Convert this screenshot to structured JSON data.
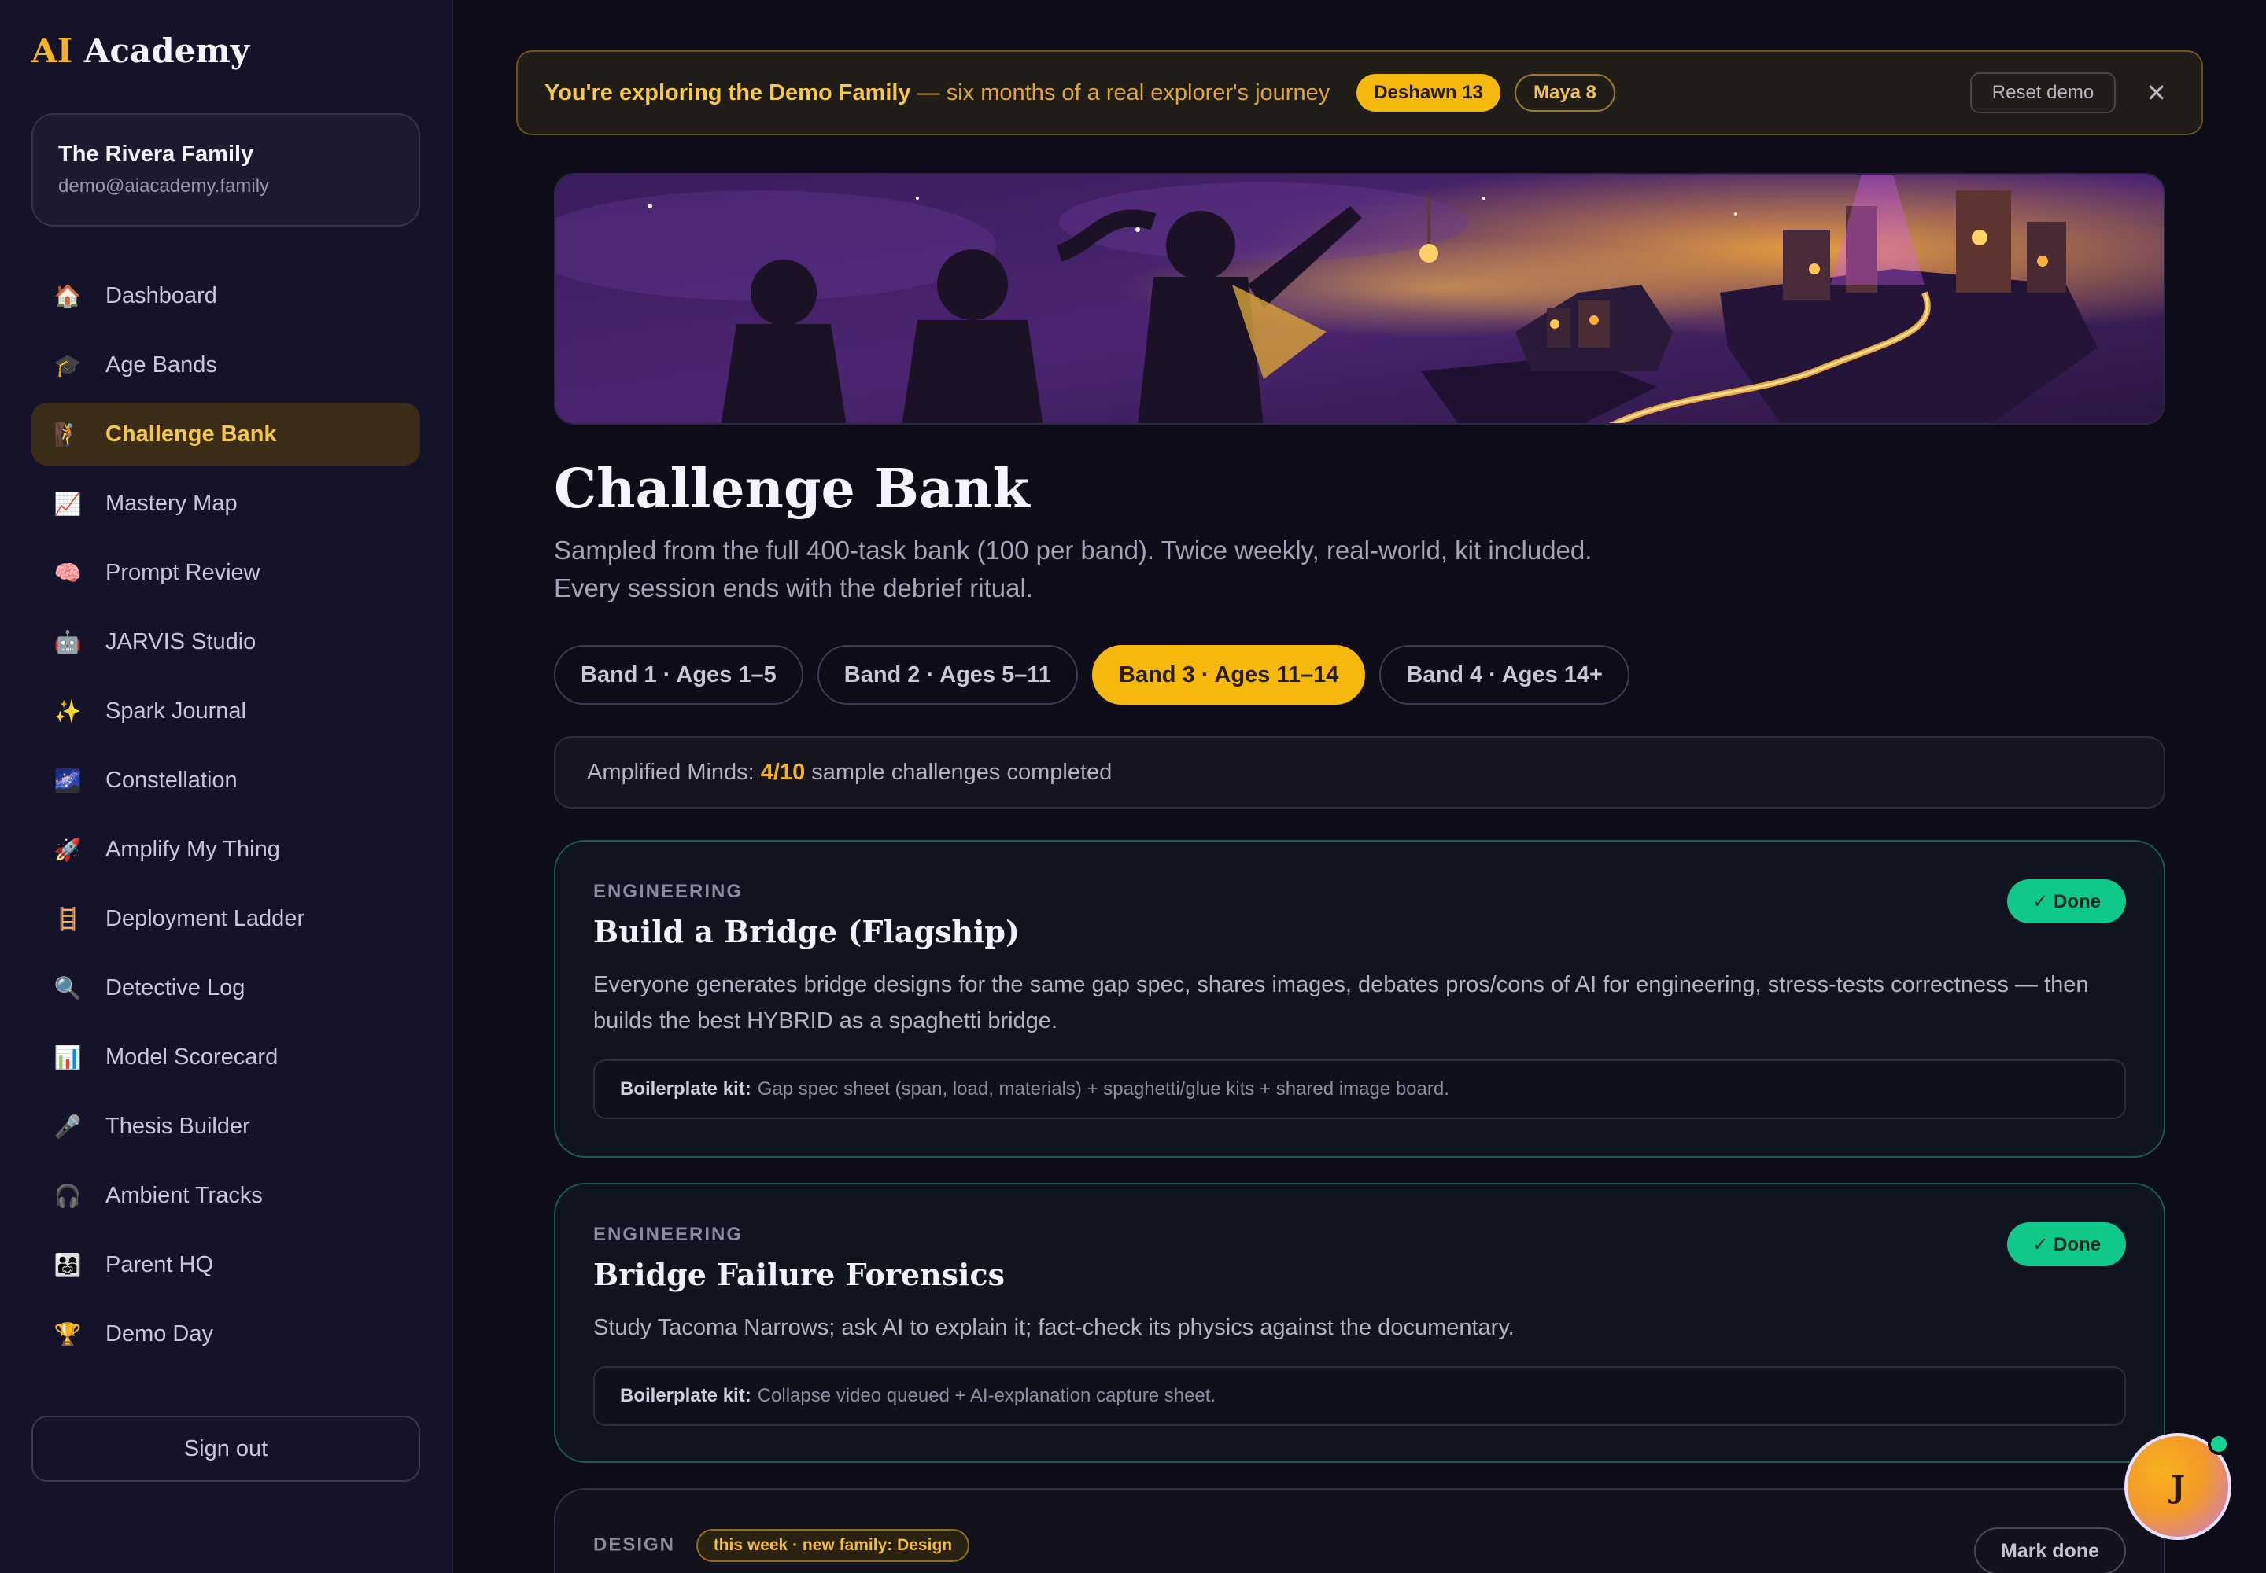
{
  "sidebar": {
    "logo_ai": "AI",
    "logo_rest": "Academy",
    "family_name": "The Rivera Family",
    "family_email": "demo@aiacademy.family",
    "items": [
      {
        "icon": "🏠",
        "label": "Dashboard"
      },
      {
        "icon": "🎓",
        "label": "Age Bands"
      },
      {
        "icon": "🧗",
        "label": "Challenge Bank"
      },
      {
        "icon": "📈",
        "label": "Mastery Map"
      },
      {
        "icon": "🧠",
        "label": "Prompt Review"
      },
      {
        "icon": "🤖",
        "label": "JARVIS Studio"
      },
      {
        "icon": "✨",
        "label": "Spark Journal"
      },
      {
        "icon": "🌌",
        "label": "Constellation"
      },
      {
        "icon": "🚀",
        "label": "Amplify My Thing"
      },
      {
        "icon": "🪜",
        "label": "Deployment Ladder"
      },
      {
        "icon": "🔍",
        "label": "Detective Log"
      },
      {
        "icon": "📊",
        "label": "Model Scorecard"
      },
      {
        "icon": "🎤",
        "label": "Thesis Builder"
      },
      {
        "icon": "🎧",
        "label": "Ambient Tracks"
      },
      {
        "icon": "👨‍👩‍👧",
        "label": "Parent HQ"
      },
      {
        "icon": "🏆",
        "label": "Demo Day"
      }
    ],
    "active_item": "Challenge Bank",
    "sign_out": "Sign out"
  },
  "banner": {
    "lead": "You're exploring the Demo Family",
    "rest": " — six months of a real explorer's journey",
    "pill_1": "Deshawn 13",
    "pill_2": "Maya 8",
    "reset": "Reset demo",
    "close": "✕"
  },
  "page": {
    "title": "Challenge Bank",
    "subtitle": "Sampled from the full 400-task bank (100 per band). Twice weekly, real-world, kit included. Every session ends with the debrief ritual."
  },
  "bands": [
    {
      "label": "Band 1 · Ages 1–5"
    },
    {
      "label": "Band 2 · Ages 5–11"
    },
    {
      "label": "Band 3 · Ages 11–14"
    },
    {
      "label": "Band 4 · Ages 14+"
    }
  ],
  "active_band": "Band 3 · Ages 11–14",
  "progress": {
    "prefix": "Amplified Minds:",
    "value": "4/10",
    "suffix": "sample challenges completed"
  },
  "cards": [
    {
      "category": "ENGINEERING",
      "title": "Build a Bridge (Flagship)",
      "description": "Everyone generates bridge designs for the same gap spec, shares images, debates pros/cons of AI for engineering, stress-tests correctness — then builds the best HYBRID as a spaghetti bridge.",
      "kit_label": "Boilerplate kit:",
      "kit_text": "Gap spec sheet (span, load, materials) + spaghetti/glue kits + shared image board.",
      "status": "✓ Done"
    },
    {
      "category": "ENGINEERING",
      "title": "Bridge Failure Forensics",
      "description": "Study Tacoma Narrows; ask AI to explain it; fact-check its physics against the documentary.",
      "kit_label": "Boilerplate kit:",
      "kit_text": "Collapse video queued + AI-explanation capture sheet.",
      "status": "✓ Done"
    },
    {
      "category": "DESIGN",
      "tag": "this week · new family: Design",
      "action": "Mark done"
    }
  ],
  "fab": {
    "initial": "J"
  },
  "colors": {
    "accent": "#f5b80c",
    "done": "#10c88a",
    "background": "#0d0c18",
    "sidebar": "#14132a"
  }
}
